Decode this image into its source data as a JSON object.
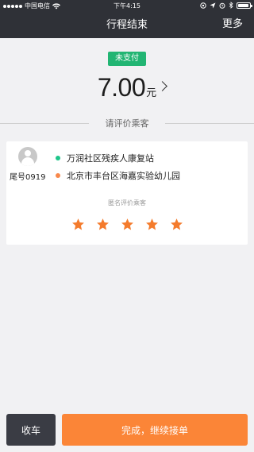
{
  "status_bar": {
    "carrier": "中国电信",
    "time": "下午4:15"
  },
  "nav": {
    "title": "行程结束",
    "more": "更多"
  },
  "payment": {
    "status": "未支付",
    "status_color": "#22b573",
    "amount": "7.00",
    "unit": "元"
  },
  "section": {
    "rate_title": "请评价乘客"
  },
  "trip": {
    "passenger_tail": "尾号0919",
    "start": "万润社区残疾人康复站",
    "end": "北京市丰台区海嘉实验幼儿园",
    "start_color": "#1ec58a",
    "end_color": "#f8884b"
  },
  "rating": {
    "hint": "匿名评价乘客",
    "stars_total": 5,
    "stars_filled": 5,
    "star_color": "#f47b2c"
  },
  "actions": {
    "stop_label": "收车",
    "continue_label": "完成，继续接单",
    "stop_color": "#3a3c44",
    "continue_color": "#fb8537"
  }
}
